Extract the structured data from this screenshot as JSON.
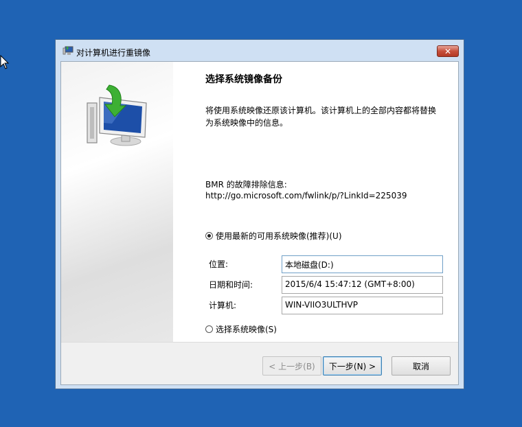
{
  "window": {
    "title": "对计算机进行重镜像",
    "close_symbol": "✕"
  },
  "main": {
    "heading": "选择系统镜像备份",
    "description": "将使用系统映像还原该计算机。该计算机上的全部内容都将替换为系统映像中的信息。",
    "bmr_label": "BMR 的故障排除信息:",
    "bmr_link": "http://go.microsoft.com/fwlink/p/?LinkId=225039",
    "option_latest": {
      "label": "使用最新的可用系统映像(推荐)(U)",
      "selected": true
    },
    "fields": [
      {
        "label": "位置:",
        "value": "本地磁盘(D:)"
      },
      {
        "label": "日期和时间:",
        "value": "2015/6/4 15:47:12 (GMT+8:00)"
      },
      {
        "label": "计算机:",
        "value": "WIN-VIIO3ULTHVP"
      }
    ],
    "option_select": {
      "label": "选择系统映像(S)",
      "selected": false
    }
  },
  "footer": {
    "back_label": "< 上一步(B)",
    "next_label": "下一步(N) >",
    "cancel_label": "取消"
  },
  "colors": {
    "desktop": "#1f63b4",
    "window_frame": "#cfe0f3",
    "close_button": "#c7503c",
    "monitor_screen": "#1d4fa8",
    "arrow_green": "#3db034"
  },
  "icons": {
    "title_icon": "computer-reimage-icon",
    "hero": "computer-restore-arrow-icon",
    "cursor": "mouse-pointer-icon"
  }
}
